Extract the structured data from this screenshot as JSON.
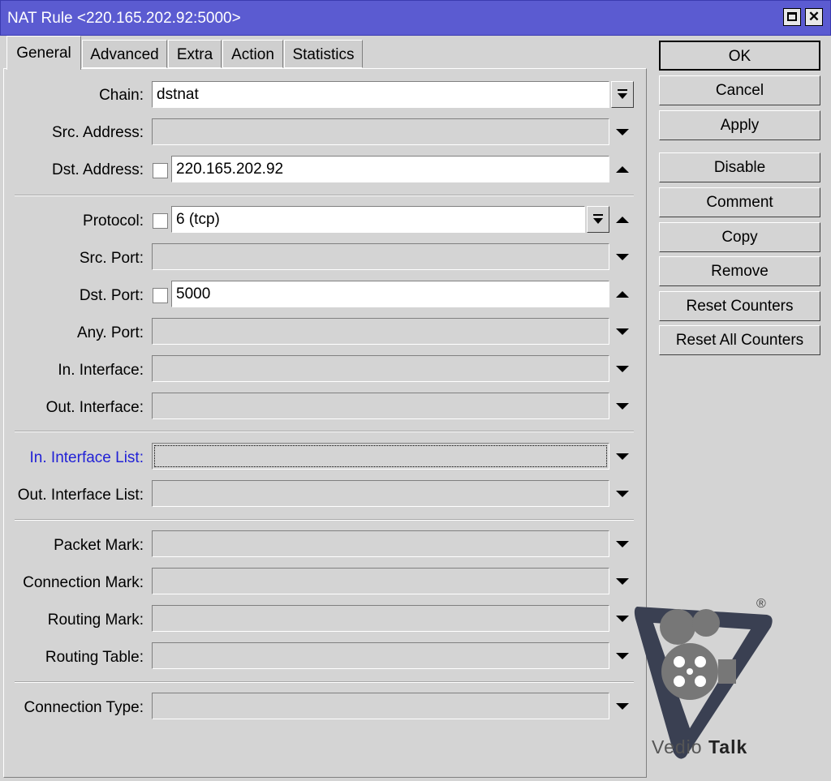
{
  "window": {
    "title": "NAT Rule <220.165.202.92:5000>"
  },
  "tabs": [
    "General",
    "Advanced",
    "Extra",
    "Action",
    "Statistics"
  ],
  "form": {
    "chain": {
      "label": "Chain:",
      "value": "dstnat"
    },
    "src_address": {
      "label": "Src. Address:"
    },
    "dst_address": {
      "label": "Dst. Address:",
      "value": "220.165.202.92"
    },
    "protocol": {
      "label": "Protocol:",
      "value": "6 (tcp)"
    },
    "src_port": {
      "label": "Src. Port:"
    },
    "dst_port": {
      "label": "Dst. Port:",
      "value": "5000"
    },
    "any_port": {
      "label": "Any. Port:"
    },
    "in_interface": {
      "label": "In. Interface:"
    },
    "out_interface": {
      "label": "Out. Interface:"
    },
    "in_interface_list": {
      "label": "In. Interface List:"
    },
    "out_interface_list": {
      "label": "Out. Interface List:"
    },
    "packet_mark": {
      "label": "Packet Mark:"
    },
    "connection_mark": {
      "label": "Connection Mark:"
    },
    "routing_mark": {
      "label": "Routing Mark:"
    },
    "routing_table": {
      "label": "Routing Table:"
    },
    "connection_type": {
      "label": "Connection Type:"
    }
  },
  "buttons": {
    "ok": "OK",
    "cancel": "Cancel",
    "apply": "Apply",
    "disable": "Disable",
    "comment": "Comment",
    "copy": "Copy",
    "remove": "Remove",
    "reset_counters": "Reset Counters",
    "reset_all_counters": "Reset All Counters"
  },
  "watermark": {
    "brand_part1": "Vedio",
    "brand_part2": "Talk",
    "registered": "®"
  },
  "colors": {
    "titlebar": "#5b5bd1",
    "focused_label": "#2121d6"
  }
}
